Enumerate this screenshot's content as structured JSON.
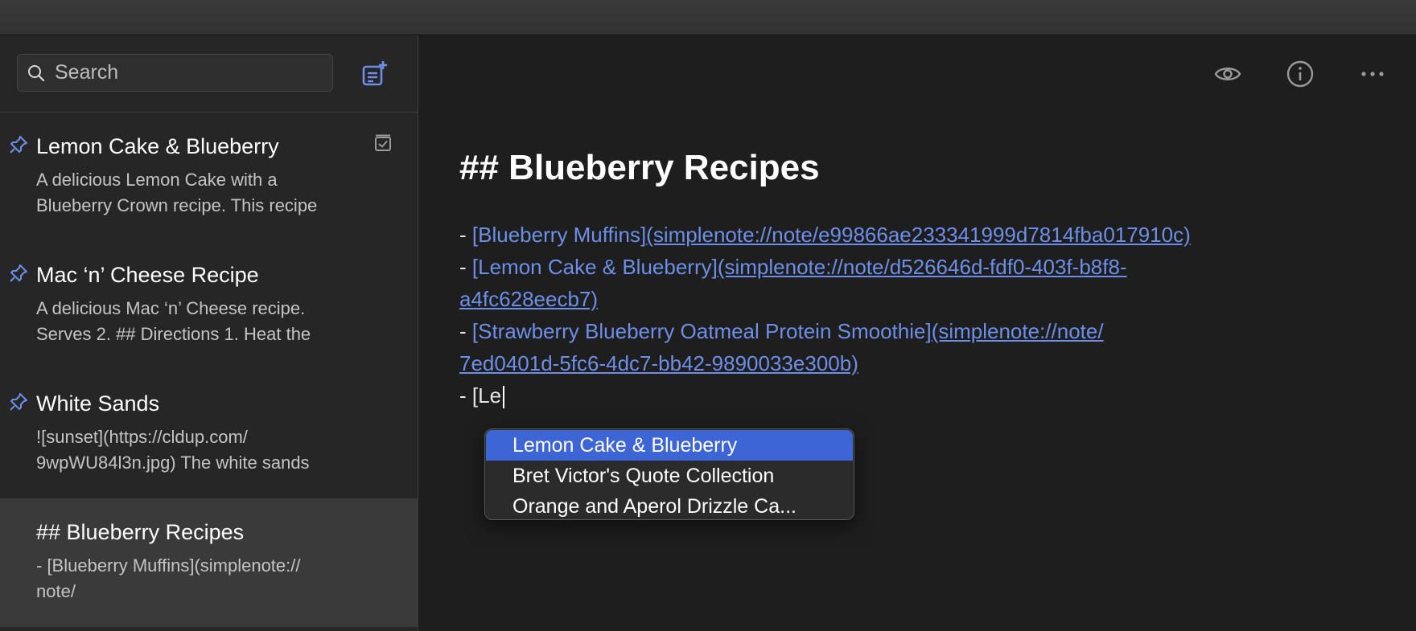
{
  "search": {
    "placeholder": "Search",
    "icon": "search-icon"
  },
  "toolbar": {
    "new_note_icon": "new-note-icon",
    "preview_icon": "eye-icon",
    "info_icon": "info-icon",
    "more_icon": "ellipsis-icon"
  },
  "colors": {
    "accent": "#6d8fe8",
    "selection": "#3d65d6",
    "sidebar_bg": "#262626",
    "editor_bg": "#1e1e1e"
  },
  "notes": [
    {
      "title": "Lemon Cake & Blueberry",
      "preview": [
        "A delicious Lemon Cake with a",
        "Blueberry Crown recipe. This recipe"
      ],
      "pinned": true,
      "checklist": true
    },
    {
      "title": "Mac ‘n’ Cheese Recipe",
      "preview": [
        "A delicious Mac ‘n’ Cheese recipe.",
        "Serves 2. ## Directions 1. Heat the"
      ],
      "pinned": true
    },
    {
      "title": "White Sands",
      "preview": [
        "![sunset](https://cldup.com/",
        "9wpWU84l3n.jpg) The white sands"
      ],
      "pinned": true
    },
    {
      "title": "## Blueberry Recipes",
      "preview": [
        "- [Blueberry Muffins](simplenote://",
        "note/"
      ],
      "pinned": false,
      "selected": true
    }
  ],
  "editor": {
    "heading": "## Blueberry Recipes",
    "bullet": "- ",
    "links": [
      {
        "text": "[Blueberry Muffins]",
        "url_lines": [
          "(simplenote://note/e99866ae233341999d7814fba017910c)"
        ]
      },
      {
        "text": "[Lemon Cake & Blueberry]",
        "url_lines": [
          "(simplenote://note/d526646d-fdf0-403f-b8f8-",
          "a4fc628eecb7)"
        ]
      },
      {
        "text": "[Strawberry Blueberry Oatmeal Protein Smoothie]",
        "url_lines": [
          "(simplenote://note/",
          "7ed0401d-5fc6-4dc7-bb42-9890033e300b)"
        ]
      }
    ],
    "typing": "- [Le"
  },
  "autocomplete": {
    "items": [
      "Lemon Cake & Blueberry",
      "Bret Victor's Quote Collection",
      "Orange and Aperol Drizzle Ca..."
    ],
    "active_index": 0
  }
}
